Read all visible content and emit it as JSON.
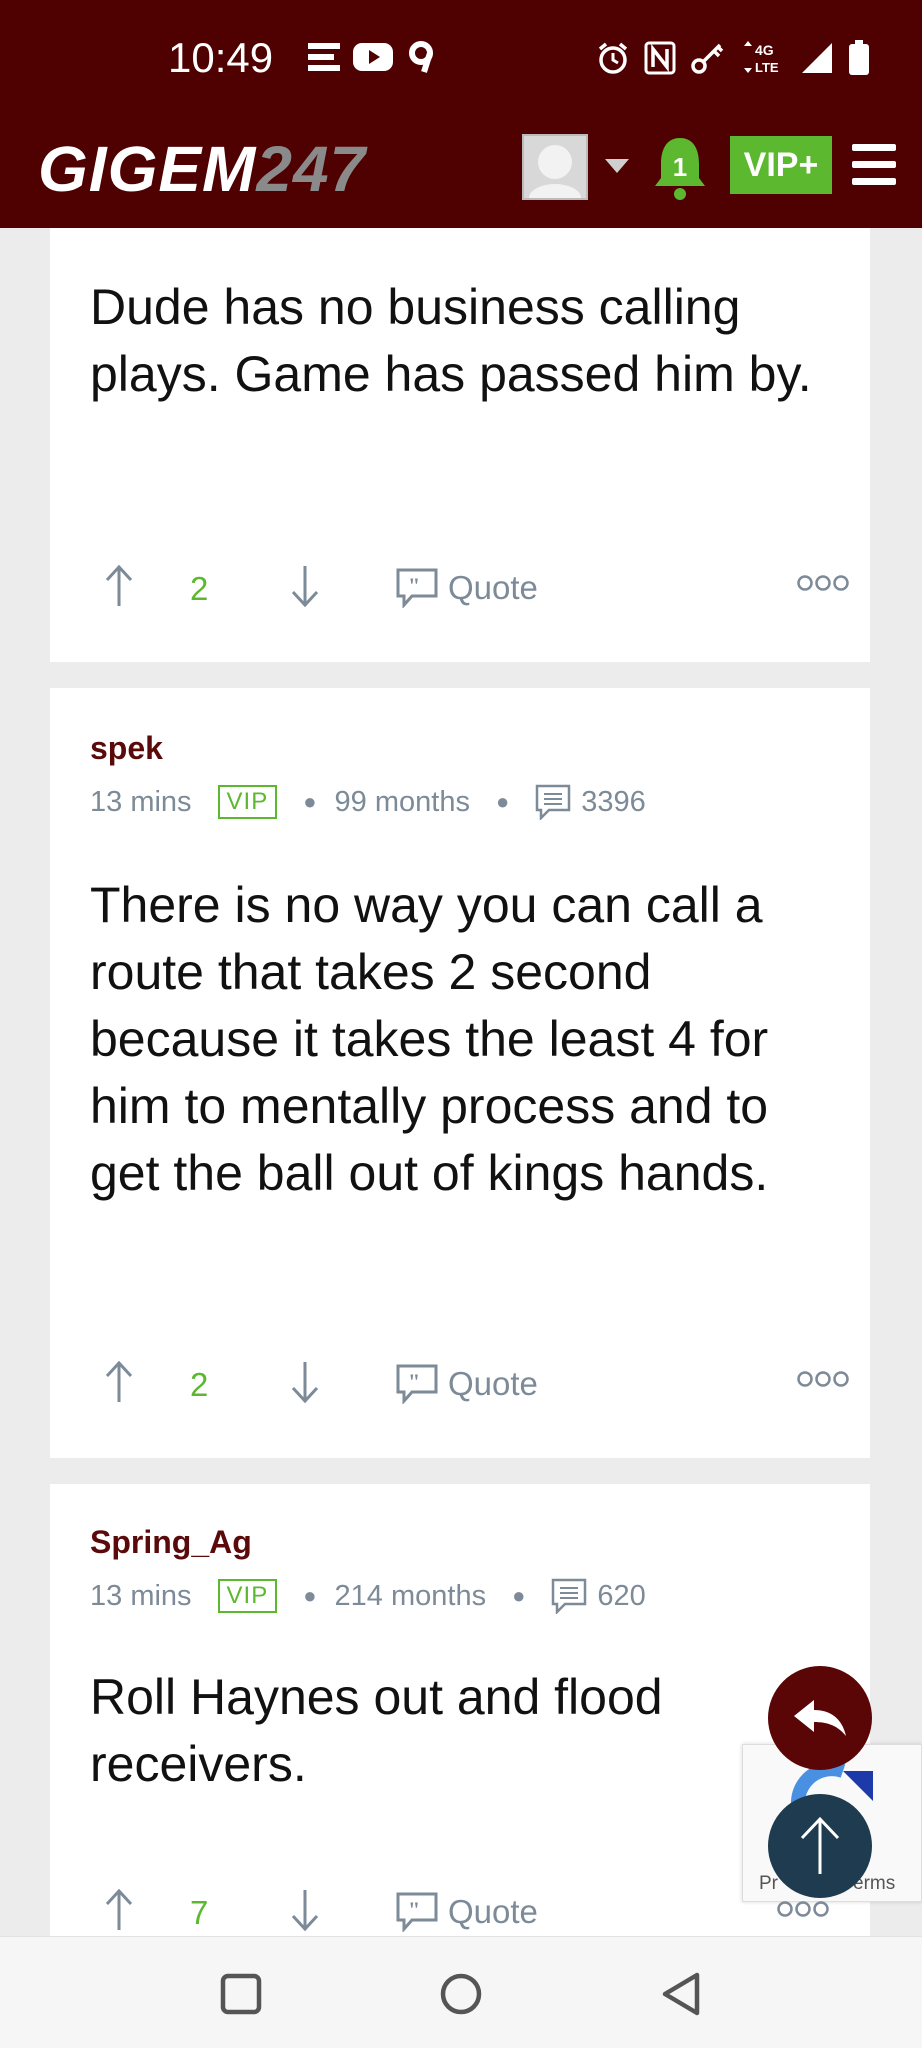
{
  "status_bar": {
    "time": "10:49",
    "left_icons": [
      "e-app-icon",
      "youtube-icon",
      "9-app-icon"
    ],
    "right_icons": [
      "alarm-icon",
      "nfc-icon",
      "vpn-key-icon",
      "4g-lte-icon",
      "signal-icon",
      "battery-icon"
    ],
    "network_label": "4G LTE"
  },
  "header": {
    "logo_main": "GIGEM",
    "logo_num": "247",
    "notification_count": "1",
    "vip_label": "VIP+",
    "colors": {
      "brand": "#4f0001",
      "accent_green": "#5cb82e"
    }
  },
  "posts": [
    {
      "username": "",
      "text": "Dude has no business calling plays. Game has passed him by.",
      "votes": "2",
      "quote_label": "Quote"
    },
    {
      "username": "spek",
      "time": "13 mins",
      "badge": "VIP",
      "tenure": "99 months",
      "post_count": "3396",
      "text": "There is no way you can call a route that takes 2 second because it takes the least 4 for him to mentally process and to get the ball out of kings hands.",
      "votes": "2",
      "quote_label": "Quote"
    },
    {
      "username": "Spring_Ag",
      "time": "13 mins",
      "badge": "VIP",
      "tenure": "214 months",
      "post_count": "620",
      "text": "Roll Haynes out and flood receivers.",
      "votes": "7",
      "quote_label": "Quote"
    }
  ],
  "recaptcha": {
    "text_left": "Pr",
    "text_right": "erms"
  },
  "nav": [
    "recents-button",
    "home-button",
    "back-button"
  ]
}
